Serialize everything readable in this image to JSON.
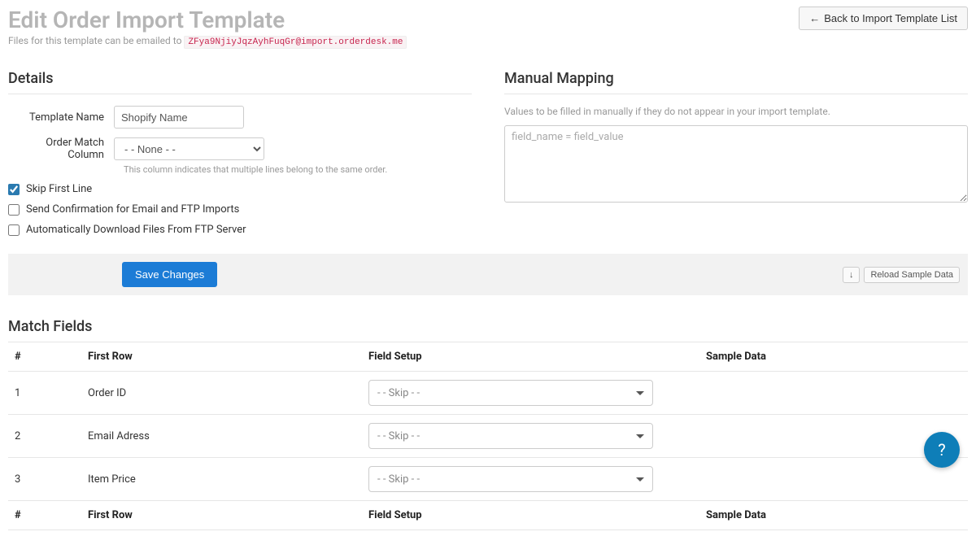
{
  "header": {
    "title": "Edit Order Import Template",
    "subtitle_prefix": "Files for this template can be emailed to",
    "email_code": "ZFya9NjiyJqzAyhFuqGr@import.orderdesk.me",
    "back_button": "Back to Import Template List"
  },
  "details": {
    "section_title": "Details",
    "template_name_label": "Template Name",
    "template_name_value": "Shopify Name",
    "order_match_label": "Order Match Column",
    "order_match_value": "- - None - -",
    "order_match_help": "This column indicates that multiple lines belong to the same order.",
    "skip_first_line_label": "Skip First Line",
    "skip_first_line_checked": true,
    "send_confirmation_label": "Send Confirmation for Email and FTP Imports",
    "send_confirmation_checked": false,
    "auto_download_label": "Automatically Download Files From FTP Server",
    "auto_download_checked": false
  },
  "mapping": {
    "section_title": "Manual Mapping",
    "description": "Values to be filled in manually if they do not appear in your import template.",
    "placeholder": "field_name = field_value"
  },
  "actions": {
    "save_label": "Save Changes",
    "reload_icon": "↓",
    "reload_label": "Reload Sample Data"
  },
  "match_fields": {
    "section_title": "Match Fields",
    "headers": {
      "num": "#",
      "first_row": "First Row",
      "field_setup": "Field Setup",
      "sample_data": "Sample Data"
    },
    "rows": [
      {
        "num": "1",
        "first_row": "Order ID",
        "field_setup": "- - Skip - -",
        "sample": ""
      },
      {
        "num": "2",
        "first_row": "Email Adress",
        "field_setup": "- - Skip - -",
        "sample": ""
      },
      {
        "num": "3",
        "first_row": "Item Price",
        "field_setup": "- - Skip - -",
        "sample": ""
      }
    ]
  },
  "help_fab": "?"
}
